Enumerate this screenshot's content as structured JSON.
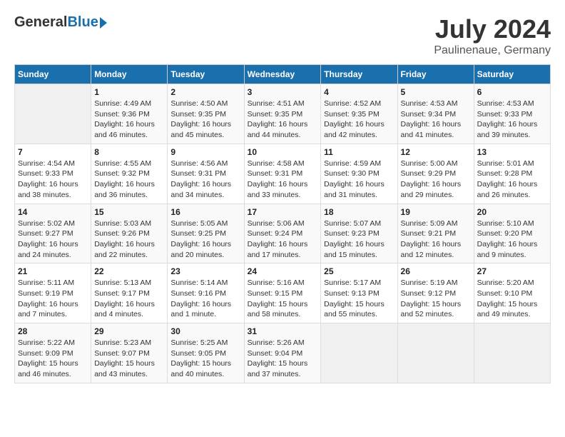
{
  "header": {
    "logo_general": "General",
    "logo_blue": "Blue",
    "month_year": "July 2024",
    "location": "Paulinenaue, Germany"
  },
  "calendar": {
    "days_of_week": [
      "Sunday",
      "Monday",
      "Tuesday",
      "Wednesday",
      "Thursday",
      "Friday",
      "Saturday"
    ],
    "weeks": [
      [
        {
          "day": "",
          "sunrise": "",
          "sunset": "",
          "daylight": ""
        },
        {
          "day": "1",
          "sunrise": "Sunrise: 4:49 AM",
          "sunset": "Sunset: 9:36 PM",
          "daylight": "Daylight: 16 hours and 46 minutes."
        },
        {
          "day": "2",
          "sunrise": "Sunrise: 4:50 AM",
          "sunset": "Sunset: 9:35 PM",
          "daylight": "Daylight: 16 hours and 45 minutes."
        },
        {
          "day": "3",
          "sunrise": "Sunrise: 4:51 AM",
          "sunset": "Sunset: 9:35 PM",
          "daylight": "Daylight: 16 hours and 44 minutes."
        },
        {
          "day": "4",
          "sunrise": "Sunrise: 4:52 AM",
          "sunset": "Sunset: 9:35 PM",
          "daylight": "Daylight: 16 hours and 42 minutes."
        },
        {
          "day": "5",
          "sunrise": "Sunrise: 4:53 AM",
          "sunset": "Sunset: 9:34 PM",
          "daylight": "Daylight: 16 hours and 41 minutes."
        },
        {
          "day": "6",
          "sunrise": "Sunrise: 4:53 AM",
          "sunset": "Sunset: 9:33 PM",
          "daylight": "Daylight: 16 hours and 39 minutes."
        }
      ],
      [
        {
          "day": "7",
          "sunrise": "Sunrise: 4:54 AM",
          "sunset": "Sunset: 9:33 PM",
          "daylight": "Daylight: 16 hours and 38 minutes."
        },
        {
          "day": "8",
          "sunrise": "Sunrise: 4:55 AM",
          "sunset": "Sunset: 9:32 PM",
          "daylight": "Daylight: 16 hours and 36 minutes."
        },
        {
          "day": "9",
          "sunrise": "Sunrise: 4:56 AM",
          "sunset": "Sunset: 9:31 PM",
          "daylight": "Daylight: 16 hours and 34 minutes."
        },
        {
          "day": "10",
          "sunrise": "Sunrise: 4:58 AM",
          "sunset": "Sunset: 9:31 PM",
          "daylight": "Daylight: 16 hours and 33 minutes."
        },
        {
          "day": "11",
          "sunrise": "Sunrise: 4:59 AM",
          "sunset": "Sunset: 9:30 PM",
          "daylight": "Daylight: 16 hours and 31 minutes."
        },
        {
          "day": "12",
          "sunrise": "Sunrise: 5:00 AM",
          "sunset": "Sunset: 9:29 PM",
          "daylight": "Daylight: 16 hours and 29 minutes."
        },
        {
          "day": "13",
          "sunrise": "Sunrise: 5:01 AM",
          "sunset": "Sunset: 9:28 PM",
          "daylight": "Daylight: 16 hours and 26 minutes."
        }
      ],
      [
        {
          "day": "14",
          "sunrise": "Sunrise: 5:02 AM",
          "sunset": "Sunset: 9:27 PM",
          "daylight": "Daylight: 16 hours and 24 minutes."
        },
        {
          "day": "15",
          "sunrise": "Sunrise: 5:03 AM",
          "sunset": "Sunset: 9:26 PM",
          "daylight": "Daylight: 16 hours and 22 minutes."
        },
        {
          "day": "16",
          "sunrise": "Sunrise: 5:05 AM",
          "sunset": "Sunset: 9:25 PM",
          "daylight": "Daylight: 16 hours and 20 minutes."
        },
        {
          "day": "17",
          "sunrise": "Sunrise: 5:06 AM",
          "sunset": "Sunset: 9:24 PM",
          "daylight": "Daylight: 16 hours and 17 minutes."
        },
        {
          "day": "18",
          "sunrise": "Sunrise: 5:07 AM",
          "sunset": "Sunset: 9:23 PM",
          "daylight": "Daylight: 16 hours and 15 minutes."
        },
        {
          "day": "19",
          "sunrise": "Sunrise: 5:09 AM",
          "sunset": "Sunset: 9:21 PM",
          "daylight": "Daylight: 16 hours and 12 minutes."
        },
        {
          "day": "20",
          "sunrise": "Sunrise: 5:10 AM",
          "sunset": "Sunset: 9:20 PM",
          "daylight": "Daylight: 16 hours and 9 minutes."
        }
      ],
      [
        {
          "day": "21",
          "sunrise": "Sunrise: 5:11 AM",
          "sunset": "Sunset: 9:19 PM",
          "daylight": "Daylight: 16 hours and 7 minutes."
        },
        {
          "day": "22",
          "sunrise": "Sunrise: 5:13 AM",
          "sunset": "Sunset: 9:17 PM",
          "daylight": "Daylight: 16 hours and 4 minutes."
        },
        {
          "day": "23",
          "sunrise": "Sunrise: 5:14 AM",
          "sunset": "Sunset: 9:16 PM",
          "daylight": "Daylight: 16 hours and 1 minute."
        },
        {
          "day": "24",
          "sunrise": "Sunrise: 5:16 AM",
          "sunset": "Sunset: 9:15 PM",
          "daylight": "Daylight: 15 hours and 58 minutes."
        },
        {
          "day": "25",
          "sunrise": "Sunrise: 5:17 AM",
          "sunset": "Sunset: 9:13 PM",
          "daylight": "Daylight: 15 hours and 55 minutes."
        },
        {
          "day": "26",
          "sunrise": "Sunrise: 5:19 AM",
          "sunset": "Sunset: 9:12 PM",
          "daylight": "Daylight: 15 hours and 52 minutes."
        },
        {
          "day": "27",
          "sunrise": "Sunrise: 5:20 AM",
          "sunset": "Sunset: 9:10 PM",
          "daylight": "Daylight: 15 hours and 49 minutes."
        }
      ],
      [
        {
          "day": "28",
          "sunrise": "Sunrise: 5:22 AM",
          "sunset": "Sunset: 9:09 PM",
          "daylight": "Daylight: 15 hours and 46 minutes."
        },
        {
          "day": "29",
          "sunrise": "Sunrise: 5:23 AM",
          "sunset": "Sunset: 9:07 PM",
          "daylight": "Daylight: 15 hours and 43 minutes."
        },
        {
          "day": "30",
          "sunrise": "Sunrise: 5:25 AM",
          "sunset": "Sunset: 9:05 PM",
          "daylight": "Daylight: 15 hours and 40 minutes."
        },
        {
          "day": "31",
          "sunrise": "Sunrise: 5:26 AM",
          "sunset": "Sunset: 9:04 PM",
          "daylight": "Daylight: 15 hours and 37 minutes."
        },
        {
          "day": "",
          "sunrise": "",
          "sunset": "",
          "daylight": ""
        },
        {
          "day": "",
          "sunrise": "",
          "sunset": "",
          "daylight": ""
        },
        {
          "day": "",
          "sunrise": "",
          "sunset": "",
          "daylight": ""
        }
      ]
    ]
  }
}
